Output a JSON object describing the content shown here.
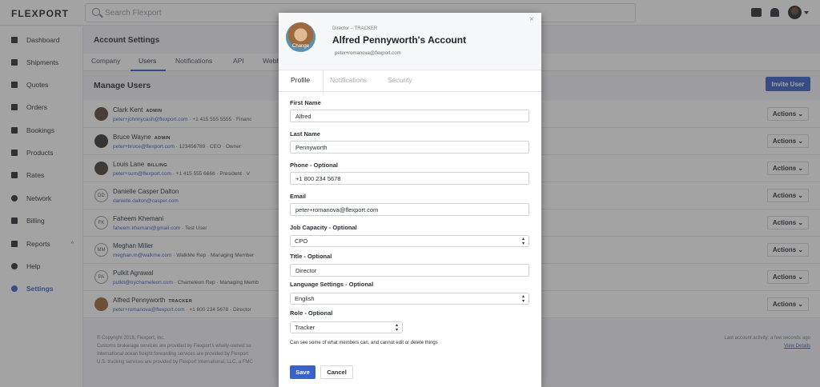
{
  "app": {
    "logo": "FLEXPORT",
    "search_placeholder": "Search Flexport"
  },
  "sidebar": {
    "items": [
      {
        "label": "Dashboard",
        "icon": "dashboard-icon"
      },
      {
        "label": "Shipments",
        "icon": "shipments-icon"
      },
      {
        "label": "Quotes",
        "icon": "quotes-icon"
      },
      {
        "label": "Orders",
        "icon": "orders-icon"
      },
      {
        "label": "Bookings",
        "icon": "bookings-icon"
      },
      {
        "label": "Products",
        "icon": "tag-icon"
      },
      {
        "label": "Rates",
        "icon": "bar-chart-icon"
      },
      {
        "label": "Network",
        "icon": "globe-icon"
      },
      {
        "label": "Billing",
        "icon": "credit-card-icon"
      },
      {
        "label": "Reports",
        "icon": "reports-icon",
        "chevron": "^"
      },
      {
        "label": "Help",
        "icon": "help-icon"
      },
      {
        "label": "Settings",
        "icon": "gear-icon",
        "active": true
      }
    ]
  },
  "page": {
    "title": "Account Settings",
    "tabs": [
      "Company",
      "Users",
      "Notifications",
      "API",
      "Webh"
    ],
    "section_title": "Manage Users",
    "invite_label": "Invite User",
    "actions_label": "Actions ⌄"
  },
  "users": [
    {
      "name": "Clark Kent",
      "badge": "ADMIN",
      "email": "peter+johnnycash@flexport.com",
      "rest": " · +1 415 555 5555 · Financ",
      "avatar": ""
    },
    {
      "name": "Bruce Wayne",
      "badge": "ADMIN",
      "email": "peter+bruce@flexport.com",
      "rest": " · 123456789 · CEO · Owner",
      "avatar": ""
    },
    {
      "name": "Louis Lane",
      "badge": "BILLING",
      "email": "peter+sum@flexport.com",
      "rest": " · +1 415 555 6666 · President · V",
      "avatar": ""
    },
    {
      "name": "Danielle Casper Dalton",
      "badge": "",
      "email": "danielle.dalton@casper.com",
      "rest": "",
      "avatar": "DD"
    },
    {
      "name": "Faheem Khemani",
      "badge": "",
      "email": "faheem.khemani@gmail.com",
      "rest": " · Test User",
      "avatar": "FK"
    },
    {
      "name": "Meghan Miller",
      "badge": "",
      "email": "meghan.m@walkme.com",
      "rest": " · WalkMe Rep · Managing Member",
      "avatar": "MM"
    },
    {
      "name": "Pulkit Agrawal",
      "badge": "",
      "email": "pulkit@trychameleon.com",
      "rest": " · Chameleon Rep · Managing Memb",
      "avatar": "PA"
    },
    {
      "name": "Alfred Pennyworth",
      "badge": "TRACKER",
      "email": "peter+romanova@flexport.com",
      "rest": " · +1 800 234 5678 · Director",
      "avatar": ""
    }
  ],
  "footer": {
    "copyright": "© Copyright 2018, Flexport, Inc.",
    "line1": "Customs brokerage services are provided by Flexport's wholly-owned su",
    "line2": "International ocean freight forwarding services are provided by Flexport",
    "line3": "U.S. trucking services are provided by Flexport International, LLC, a FMC",
    "activity": "Last account activity: a few seconds ago",
    "details": "View Details"
  },
  "modal": {
    "subtitle": "Director – TRACKER",
    "title": "Alfred Pennyworth's Account",
    "email": "peter+romanova@flexport.com",
    "avatar_label": "Change",
    "close": "×",
    "tabs": [
      "Profile",
      "Notifications",
      "Security"
    ],
    "fields": {
      "first_name_label": "First Name",
      "first_name": "Alfred",
      "last_name_label": "Last Name",
      "last_name": "Pennyworth",
      "phone_label": "Phone - Optional",
      "phone": "+1 800 234 5678",
      "email_label": "Email",
      "email": "peter+romanova@flexport.com",
      "capacity_label": "Job Capacity - Optional",
      "capacity": "CPO",
      "title_label": "Title - Optional",
      "title": "Director",
      "language_label": "Language Settings - Optional",
      "language": "English",
      "role_label": "Role - Optional",
      "role": "Tracker"
    },
    "help_text": "Can see some of what members can, and cannot edit or delete things",
    "save_label": "Save",
    "cancel_label": "Cancel"
  },
  "colors": {
    "accent": "#3b62c9"
  }
}
